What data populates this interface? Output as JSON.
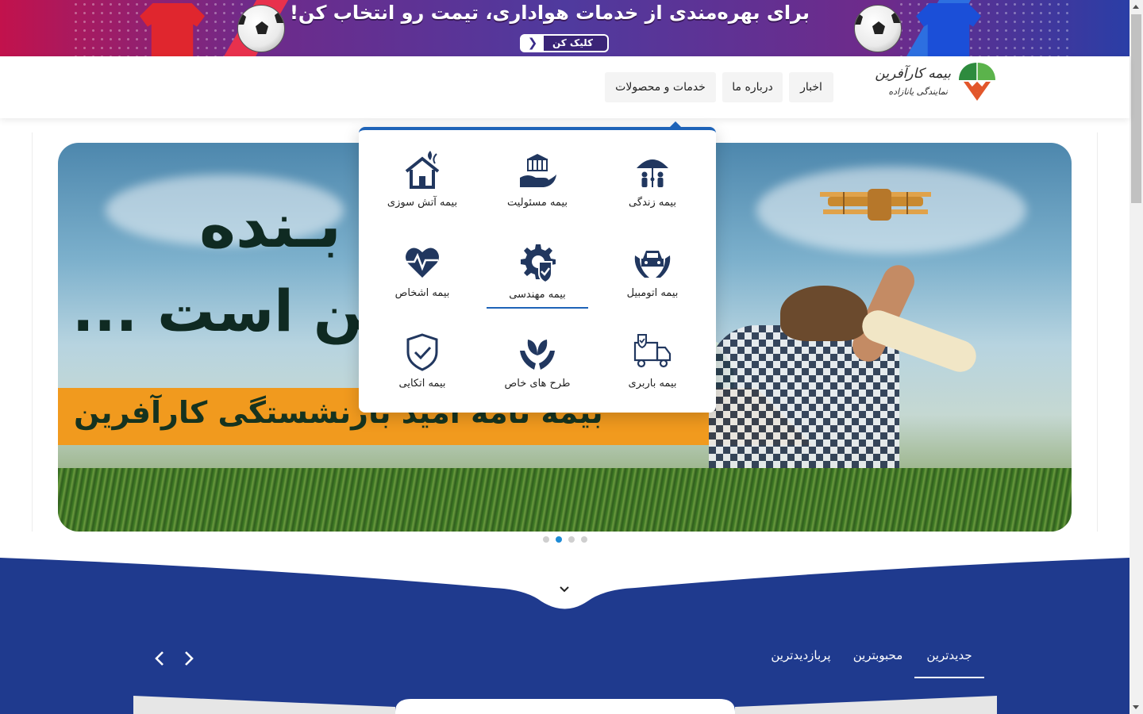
{
  "promo": {
    "title": "برای بهره‌مندی از خدمات هواداری، تیمت رو انتخاب کن!",
    "button_label": "کلیک کن",
    "button_icon": "chevron-left-icon"
  },
  "header": {
    "logo": {
      "brand": "بیمه کارآفرین",
      "subtitle": "نمایندگی یانازاده"
    },
    "nav": [
      {
        "label": "اخبار"
      },
      {
        "label": "درباره ما"
      },
      {
        "label": "خدمات و محصولات"
      }
    ]
  },
  "hero": {
    "headline_line1": "بـنده",
    "headline_line2": "ـن است ...",
    "caption": "بیمه نامه امید بازنشستگی کارآفرین",
    "slides": 4,
    "active_slide": 2
  },
  "menu": {
    "items": [
      {
        "label": "بیمه زندگی",
        "icon": "family-umbrella-icon"
      },
      {
        "label": "بیمه مسئولیت",
        "icon": "hand-building-icon"
      },
      {
        "label": "بیمه آتش سوزی",
        "icon": "house-fire-icon"
      },
      {
        "label": "بیمه اتومبیل",
        "icon": "car-hands-icon"
      },
      {
        "label": "بیمه مهندسی",
        "icon": "gear-check-icon",
        "selected": true
      },
      {
        "label": "بیمه اشخاص",
        "icon": "heart-pulse-icon"
      },
      {
        "label": "بیمه باربری",
        "icon": "truck-shield-icon"
      },
      {
        "label": "طرح های خاص",
        "icon": "hands-leaf-icon"
      },
      {
        "label": "بیمه اتکایی",
        "icon": "shield-check-icon"
      }
    ]
  },
  "news": {
    "tabs": [
      {
        "label": "جدیدترین",
        "active": true
      },
      {
        "label": "محبوبترین"
      },
      {
        "label": "پربازدیدترین"
      }
    ],
    "prev_icon": "chevron-left-icon",
    "next_icon": "chevron-right-icon",
    "scroll_icon": "chevron-down-icon"
  },
  "colors": {
    "accent": "#1e63b8",
    "section_bg": "#1f3a8e",
    "active_dot": "#1d8bd6",
    "hero_strip": "#f19a1e"
  }
}
